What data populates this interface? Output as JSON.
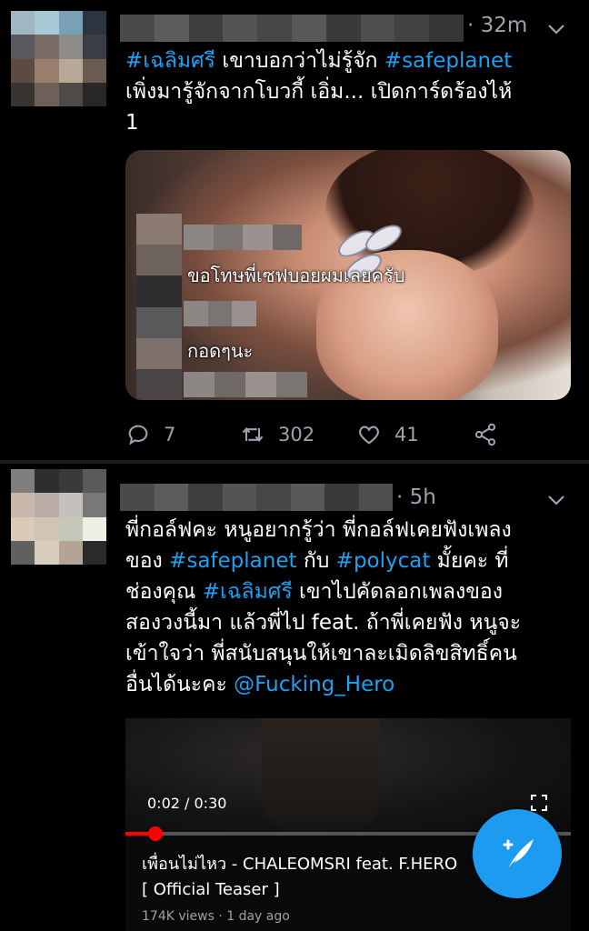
{
  "tweets": [
    {
      "time": "32m",
      "text_parts": [
        {
          "kind": "tag",
          "text": "#เฉลิมศรี"
        },
        {
          "kind": "plain",
          "text": " เขาบอกว่าไม่รู้จัก "
        },
        {
          "kind": "tag",
          "text": "#safeplanet"
        },
        {
          "kind": "plain",
          "text": "\nเพิ่งมารู้จักจากโบวกี้ เอิ่ม... เปิดการ์ดร้องไห้\n1"
        }
      ],
      "media_overlay": {
        "line1": "ขอโทษพี่เซฟบอยผมเลยครับ",
        "line2": "กอดๆนะ"
      },
      "actions": {
        "replies": "7",
        "retweets": "302",
        "likes": "41"
      }
    },
    {
      "time": "5h",
      "text_parts": [
        {
          "kind": "plain",
          "text": "พี่กอล์ฟคะ หนูอยากรู้ว่า พี่กอล์ฟเคยฟังเพลง\nของ "
        },
        {
          "kind": "tag",
          "text": "#safeplanet"
        },
        {
          "kind": "plain",
          "text": " กับ "
        },
        {
          "kind": "tag",
          "text": "#polycat"
        },
        {
          "kind": "plain",
          "text": " มั้ยคะ ที่\nช่องคุณ "
        },
        {
          "kind": "tag",
          "text": "#เฉลิมศรี"
        },
        {
          "kind": "plain",
          "text": " เขาไปคัดลอกเพลงของ\nสองวงนี้มา แล้วพี่ไป feat. ถ้าพี่เคยฟัง หนูจะ\nเข้าใจว่า พี่สนับสนุนให้เขาละเมิดลิขสิทธิ์คน\nอื่นได้นะคะ "
        },
        {
          "kind": "mention",
          "text": "@Fucking_Hero"
        }
      ],
      "video": {
        "time_display": "0:02 / 0:30",
        "progress": 0.067,
        "title": "เพื่อนไม่ไหว - CHALEOMSRI feat. F.HERO\n[ Official Teaser ]",
        "views": "174K views · 1 day ago"
      }
    }
  ],
  "colors": {
    "accent": "#1da1f2",
    "muted": "#9aa4ad",
    "fab": "#1d9bf0"
  },
  "icons": {
    "reply": "reply-icon",
    "retweet": "retweet-icon",
    "like": "heart-icon",
    "share": "share-icon",
    "caret": "chevron-down-icon",
    "compose": "compose-tweet-icon",
    "fullscreen": "fullscreen-icon"
  }
}
